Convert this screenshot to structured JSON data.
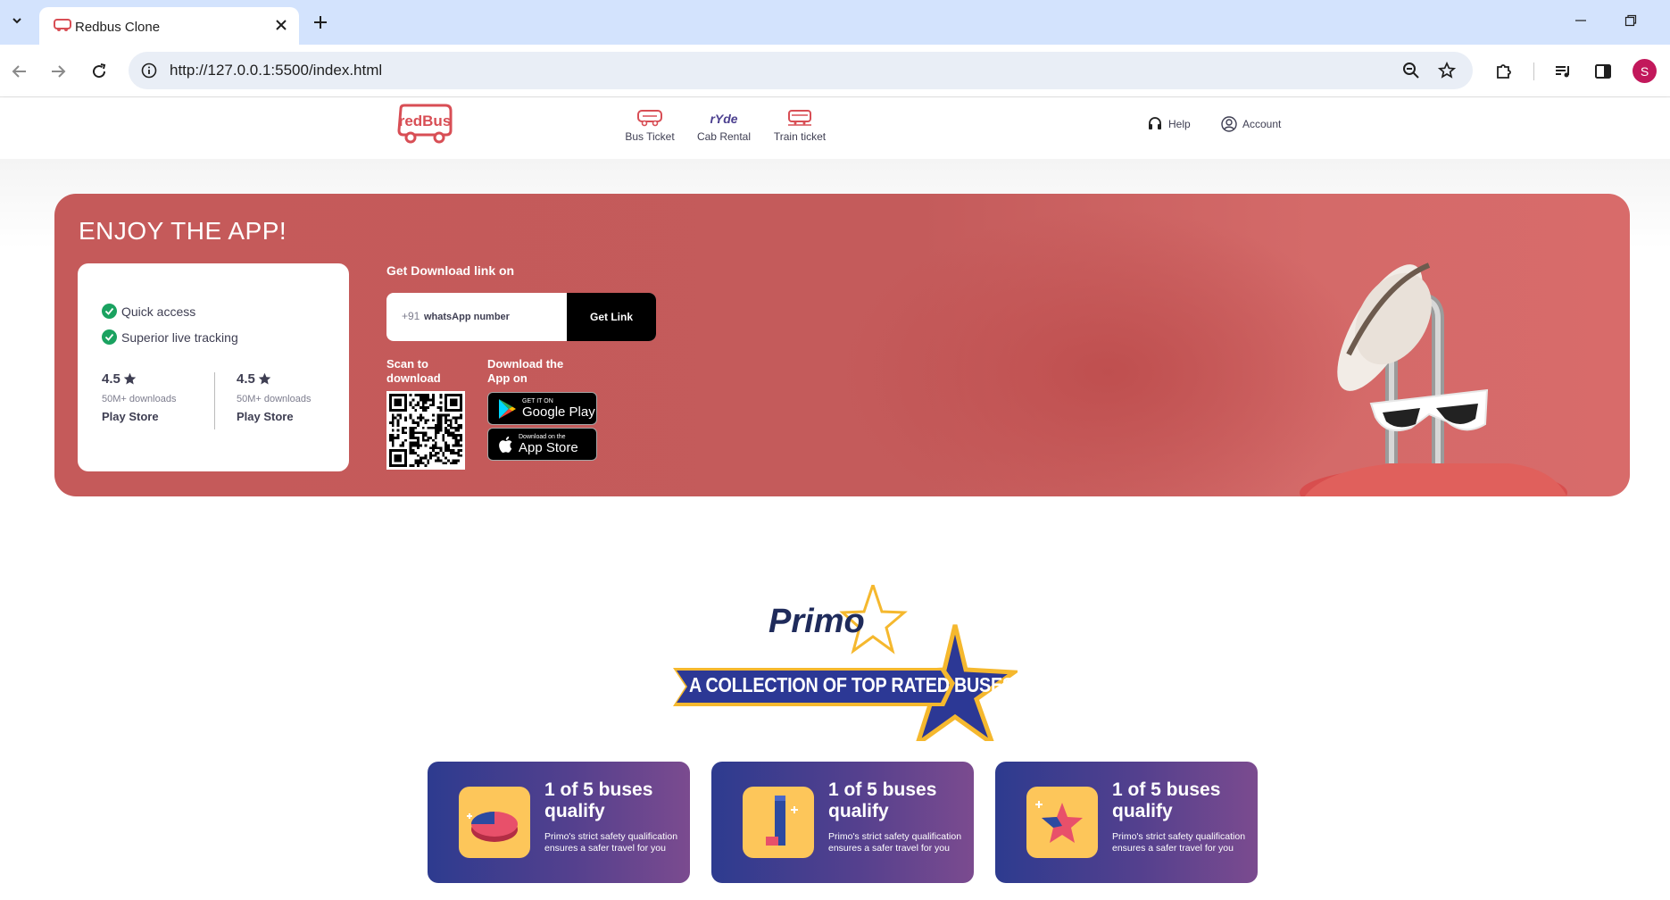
{
  "browser": {
    "tab_title": "Redbus Clone",
    "url": "http://127.0.0.1:5500/index.html",
    "profile_initial": "S"
  },
  "header": {
    "logo_text": "redBus",
    "nav": [
      {
        "label": "Bus Ticket",
        "icon": "bus-ticket-icon"
      },
      {
        "label": "Cab Rental",
        "icon": "ryde-icon"
      },
      {
        "label": "Train ticket",
        "icon": "train-ticket-icon"
      }
    ],
    "help_label": "Help",
    "account_label": "Account"
  },
  "app_banner": {
    "title": "ENJOY THE APP!",
    "features": [
      "Quick access",
      "Superior live tracking"
    ],
    "ratings": [
      {
        "value": "4.5",
        "downloads": "50M+ downloads",
        "store": "Play Store"
      },
      {
        "value": "4.5",
        "downloads": "50M+ downloads",
        "store": "Play Store"
      }
    ],
    "download_heading": "Get Download link on",
    "phone_prefix": "+91",
    "phone_placeholder": "whatsApp number",
    "get_link_label": "Get Link",
    "scan_label": "Scan to download",
    "download_app_label": "Download the App on",
    "google_play": {
      "small": "GET IT ON",
      "big": "Google Play"
    },
    "app_store": {
      "small": "Download on the",
      "big": "App Store"
    }
  },
  "primo": {
    "logo_word": "Primo",
    "banner_text": "A COLLECTION OF TOP RATED BUSES",
    "cards": [
      {
        "title": "1 of 5 buses qualify",
        "desc": "Primo's strict safety qualification ensures a safer travel for you",
        "icon": "pie-chart-icon"
      },
      {
        "title": "1 of 5 buses qualify",
        "desc": "Primo's strict safety qualification ensures a safer travel for you",
        "icon": "bar-pillar-icon"
      },
      {
        "title": "1 of 5 buses qualify",
        "desc": "Primo's strict safety qualification ensures a safer travel for you",
        "icon": "star-block-icon"
      }
    ]
  },
  "colors": {
    "brand_red": "#d84e55",
    "banner_red": "#c55a5a",
    "primo_navy": "#1f2b5b",
    "primo_gold": "#f5b82e",
    "card_gradient_start": "#2d3b8f",
    "card_gradient_end": "#7b4b8f"
  }
}
